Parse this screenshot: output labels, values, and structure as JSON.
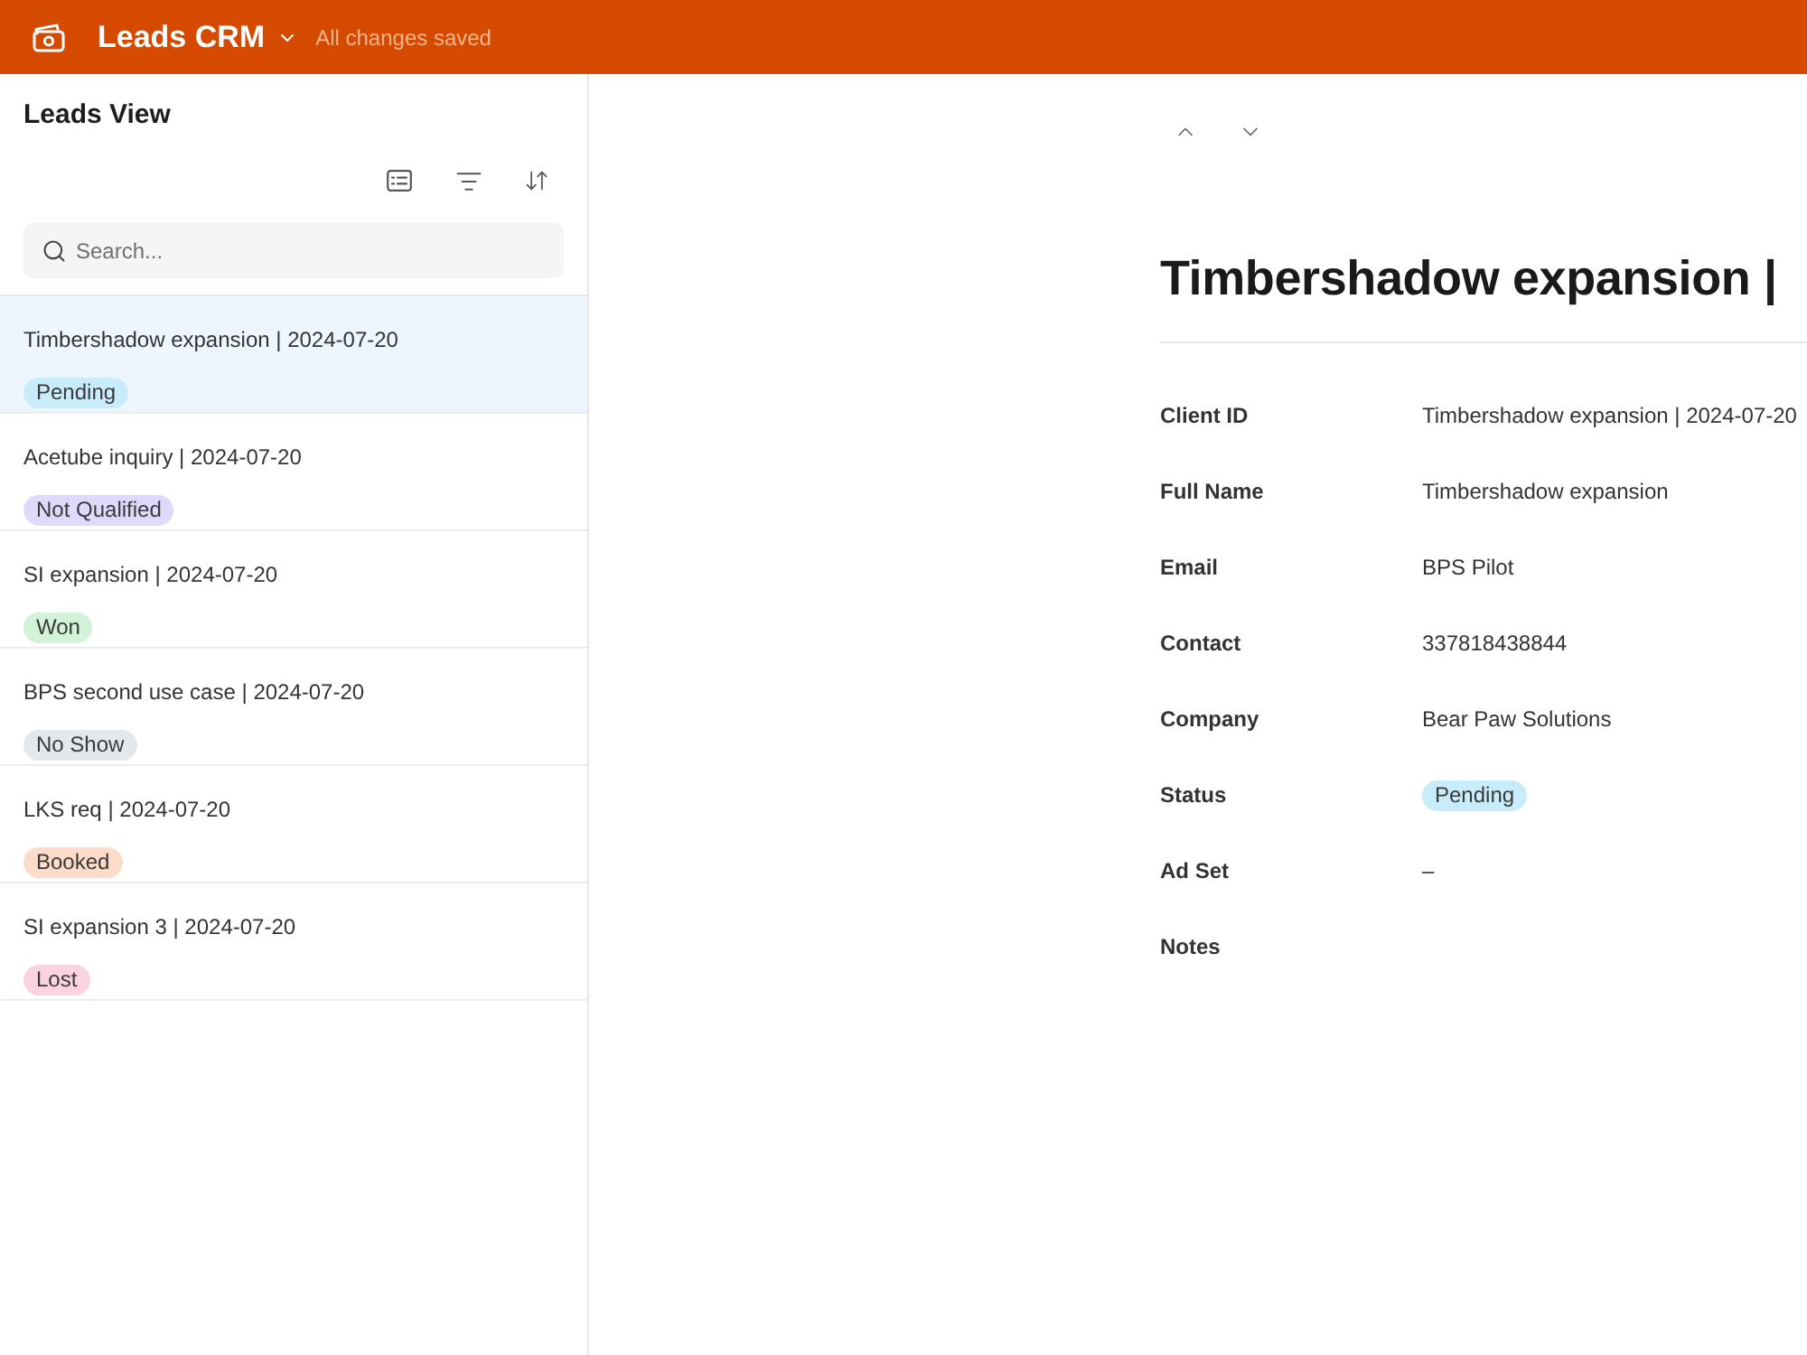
{
  "app_bar": {
    "title": "Leads CRM",
    "save_status": "All changes saved"
  },
  "list_panel": {
    "title": "Leads View",
    "search": {
      "placeholder": "Search..."
    },
    "leads": [
      {
        "title": "Timbershadow expansion | 2024-07-20",
        "status": "Pending",
        "color": "#c9ecfb",
        "selected": true
      },
      {
        "title": "Acetube inquiry | 2024-07-20",
        "status": "Not Qualified",
        "color": "#e1d9fb",
        "selected": false
      },
      {
        "title": "SI expansion | 2024-07-20",
        "status": "Won",
        "color": "#d3f3d8",
        "selected": false
      },
      {
        "title": "BPS second use case | 2024-07-20",
        "status": "No Show",
        "color": "#e4e7ec",
        "selected": false
      },
      {
        "title": "LKS req | 2024-07-20",
        "status": "Booked",
        "color": "#fcdcc8",
        "selected": false
      },
      {
        "title": "SI expansion 3 | 2024-07-20",
        "status": "Lost",
        "color": "#fbd3de",
        "selected": false
      }
    ]
  },
  "detail": {
    "title": "Timbershadow expansion |",
    "fields": [
      {
        "label": "Client ID",
        "kind": "text",
        "value": "Timbershadow expansion | 2024-07-20"
      },
      {
        "label": "Full Name",
        "kind": "text",
        "value": "Timbershadow expansion"
      },
      {
        "label": "Email",
        "kind": "text",
        "value": "BPS Pilot"
      },
      {
        "label": "Contact",
        "kind": "text",
        "value": "337818438844"
      },
      {
        "label": "Company",
        "kind": "text",
        "value": "Bear Paw Solutions"
      },
      {
        "label": "Status",
        "kind": "badge",
        "value": "Pending",
        "color": "#c9ecfb"
      },
      {
        "label": "Ad Set",
        "kind": "text",
        "value": "–"
      },
      {
        "label": "Notes",
        "kind": "text"
      }
    ]
  }
}
